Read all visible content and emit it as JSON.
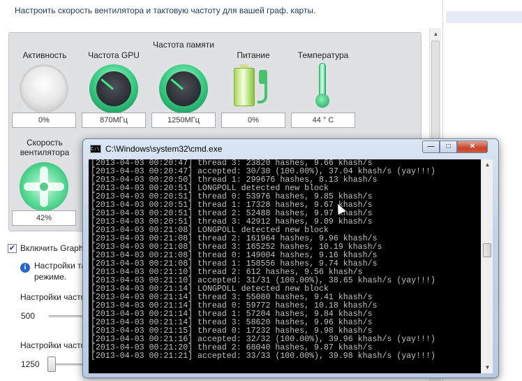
{
  "header": {
    "text": "Настроить скорость вентилятора и тактовую частоту для вашей граф. карты."
  },
  "gauges": [
    {
      "label": "Активность",
      "value": "0%"
    },
    {
      "label": "Частота GPU",
      "value": "870МГц"
    },
    {
      "label": "Частота памяти",
      "value": "1250МГц"
    },
    {
      "label": "Питание",
      "value": "0%"
    },
    {
      "label": "Температура",
      "value": "44 ° C"
    },
    {
      "label": "Скорость вентилятора",
      "value": "42%"
    }
  ],
  "enable_checkbox": {
    "label": "Включить Graphi",
    "checked": true,
    "mark": "✔"
  },
  "info": {
    "line1": "Настройки та",
    "line2": "режиме.",
    "icon": "info-icon"
  },
  "sliders": [
    {
      "label": "Настройки часто",
      "value": "500"
    },
    {
      "label": "Настройки часто",
      "value": "1250"
    }
  ],
  "cmd": {
    "title": "C:\\Windows\\system32\\cmd.exe",
    "icon_text": "C:\\",
    "buttons": {
      "minimize": "—",
      "maximize": "□",
      "close": "✕"
    },
    "lines": [
      "[2013-04-03 00:20:47] thread 3: 23820 hashes, 9.66 khash/s",
      "[2013-04-03 00:20:47] accepted: 30/30 (100.00%), 37.04 khash/s (yay!!!)",
      "[2013-04-03 00:20:50] thread 1: 299676 hashes, 8.13 khash/s",
      "[2013-04-03 00:20:51] LONGPOLL detected new block",
      "[2013-04-03 00:20:51] thread 0: 53976 hashes, 9.85 khash/s",
      "[2013-04-03 00:20:51] thread 1: 17328 hashes, 9.67 khash/s",
      "[2013-04-03 00:20:51] thread 2: 52488 hashes, 9.97 khash/s",
      "[2013-04-03 00:20:51] thread 3: 42912 hashes, 9.09 khash/s",
      "[2013-04-03 00:21:08] LONGPOLL detected new block",
      "[2013-04-03 00:21:08] thread 2: 161964 hashes, 9.96 khash/s",
      "[2013-04-03 00:21:08] thread 3: 165252 hashes, 10.19 khash/s",
      "[2013-04-03 00:21:08] thread 0: 149004 hashes, 9.16 khash/s",
      "[2013-04-03 00:21:08] thread 1: 158556 hashes, 9.74 khash/s",
      "[2013-04-03 00:21:10] thread 2: 612 hashes, 9.56 khash/s",
      "[2013-04-03 00:21:10] accepted: 31/31 (100.00%), 38.65 khash/s (yay!!!)",
      "[2013-04-03 00:21:14] LONGPOLL detected new block",
      "[2013-04-03 00:21:14] thread 3: 55080 hashes, 9.41 khash/s",
      "[2013-04-03 00:21:14] thread 0: 59772 hashes, 10.18 khash/s",
      "[2013-04-03 00:21:14] thread 1: 57204 hashes, 9.84 khash/s",
      "[2013-04-03 00:21:14] thread 3: 58620 hashes, 9.96 khash/s",
      "[2013-04-03 00:21:15] thread 0: 17232 hashes, 9.98 khash/s",
      "[2013-04-03 00:21:16] accepted: 32/32 (100.00%), 39.96 khash/s (yay!!!)",
      "[2013-04-03 00:21:20] thread 2: 68040 hashes, 9.87 khash/s",
      "[2013-04-03 00:21:21] accepted: 33/33 (100.00%), 39.98 khash/s (yay!!!)"
    ]
  }
}
